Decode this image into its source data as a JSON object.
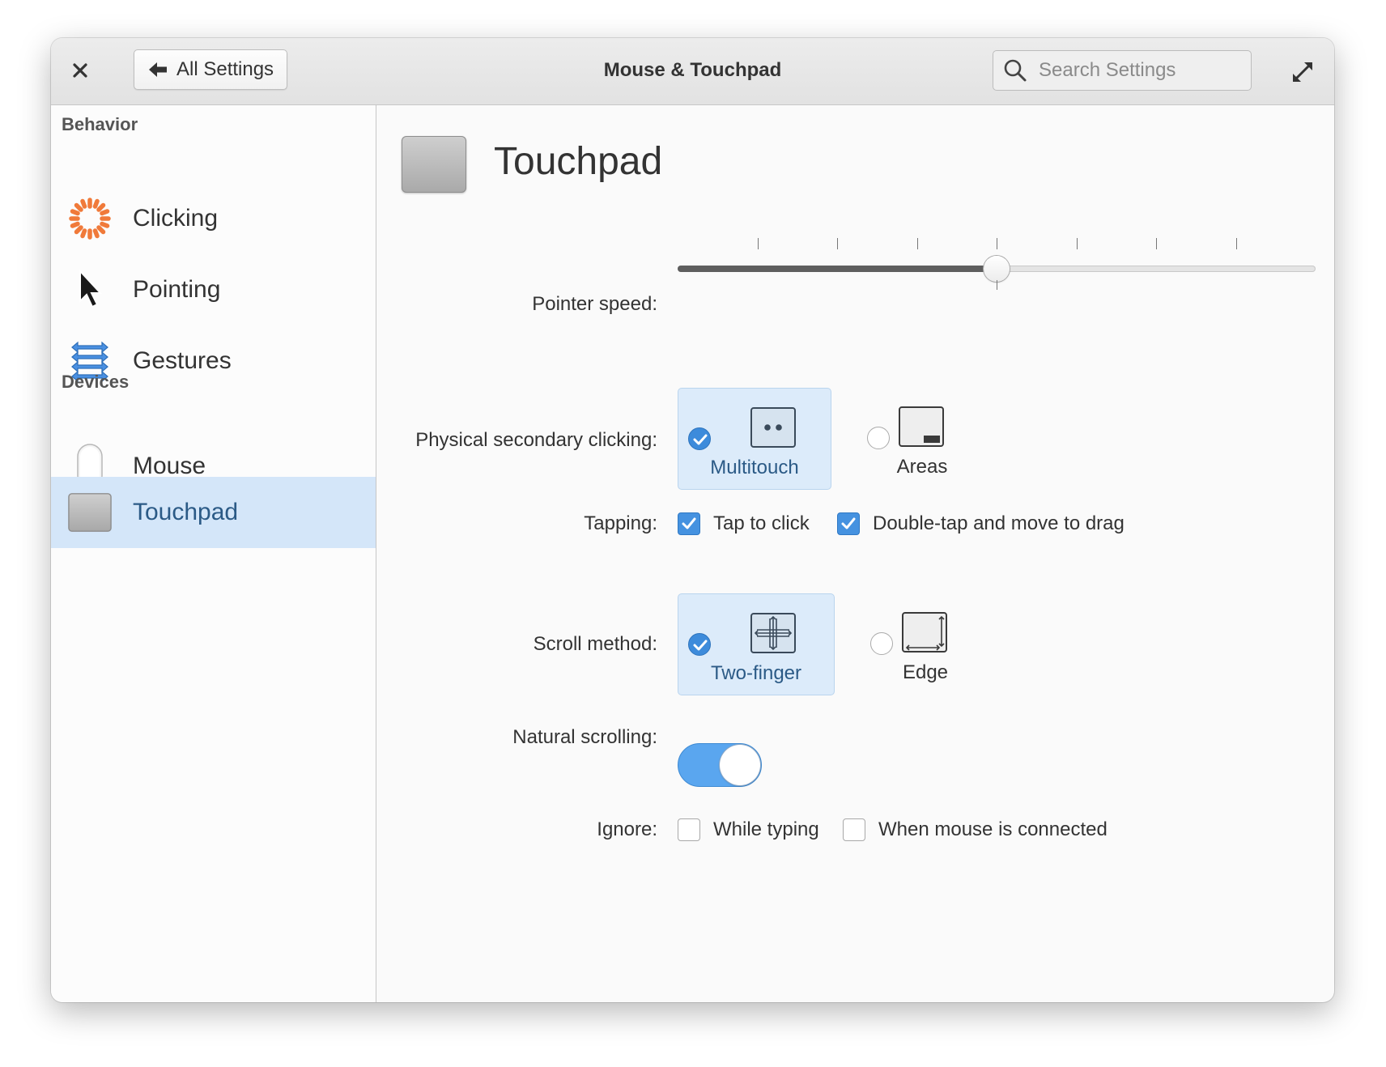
{
  "window": {
    "title": "Mouse & Touchpad",
    "back_label": "All Settings",
    "search_placeholder": "Search Settings"
  },
  "sidebar": {
    "sections": [
      {
        "title": "Behavior",
        "items": [
          {
            "label": "Clicking",
            "icon": "clicking-icon"
          },
          {
            "label": "Pointing",
            "icon": "pointer-icon"
          },
          {
            "label": "Gestures",
            "icon": "gestures-icon"
          }
        ]
      },
      {
        "title": "Devices",
        "items": [
          {
            "label": "Mouse",
            "icon": "mouse-icon"
          },
          {
            "label": "Touchpad",
            "icon": "touchpad-icon",
            "selected": true
          }
        ]
      }
    ]
  },
  "page": {
    "title": "Touchpad",
    "pointer_speed": {
      "label": "Pointer speed:",
      "value": 0.5,
      "ticks": 9
    },
    "secondary_click": {
      "label": "Physical secondary clicking:",
      "options": [
        {
          "label": "Multitouch",
          "selected": true
        },
        {
          "label": "Areas",
          "selected": false
        }
      ]
    },
    "tapping": {
      "label": "Tapping:",
      "options": [
        {
          "label": "Tap to click",
          "checked": true
        },
        {
          "label": "Double-tap and move to drag",
          "checked": true
        }
      ]
    },
    "scroll_method": {
      "label": "Scroll method:",
      "options": [
        {
          "label": "Two-finger",
          "selected": true
        },
        {
          "label": "Edge",
          "selected": false
        }
      ]
    },
    "natural_scrolling": {
      "label": "Natural scrolling:",
      "on": true
    },
    "ignore": {
      "label": "Ignore:",
      "options": [
        {
          "label": "While typing",
          "checked": false
        },
        {
          "label": "When mouse is connected",
          "checked": false
        }
      ]
    }
  },
  "colors": {
    "accent": "#3d8bdb",
    "selected_bg": "#d4e6f9",
    "switch_on": "#5aa6ef"
  }
}
